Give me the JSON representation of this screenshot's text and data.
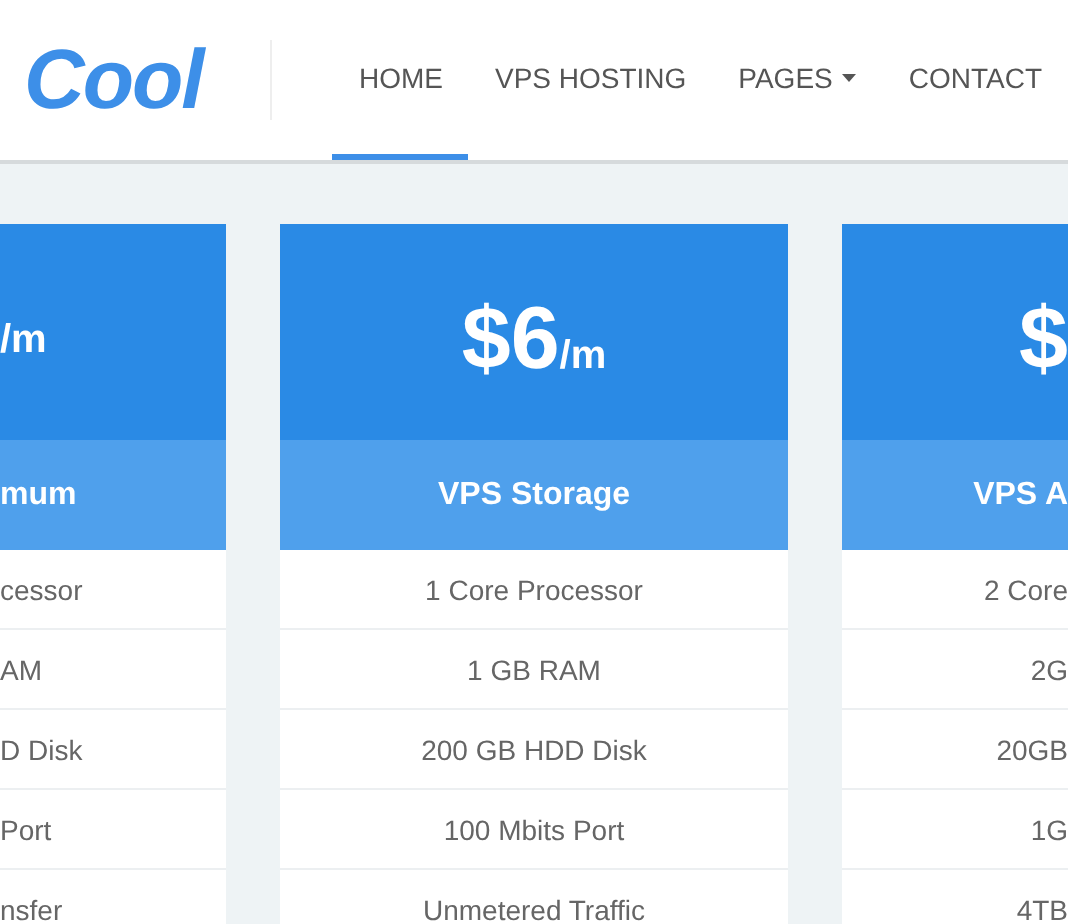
{
  "logo": {
    "accent": "Cool"
  },
  "nav": [
    {
      "label": "HOME",
      "selected": true,
      "dropdown": false
    },
    {
      "label": "VPS HOSTING",
      "selected": false,
      "dropdown": false
    },
    {
      "label": "PAGES",
      "selected": false,
      "dropdown": true
    },
    {
      "label": "CONTACT",
      "selected": false,
      "dropdown": false
    }
  ],
  "plans": [
    {
      "kind": "left",
      "period": "/m",
      "name": "mum",
      "features": [
        "cessor",
        "AM",
        "D Disk",
        "Port",
        "nsfer"
      ]
    },
    {
      "kind": "center",
      "price": "$6",
      "period": "/m",
      "name": "VPS Storage",
      "features": [
        "1 Core Processor",
        "1 GB RAM",
        "200 GB HDD Disk",
        "100 Mbits Port",
        "Unmetered Traffic"
      ]
    },
    {
      "kind": "right",
      "price": "$",
      "name": "VPS A",
      "features": [
        "2 Core",
        "2G",
        "20GB",
        "1G",
        "4TB"
      ]
    }
  ]
}
